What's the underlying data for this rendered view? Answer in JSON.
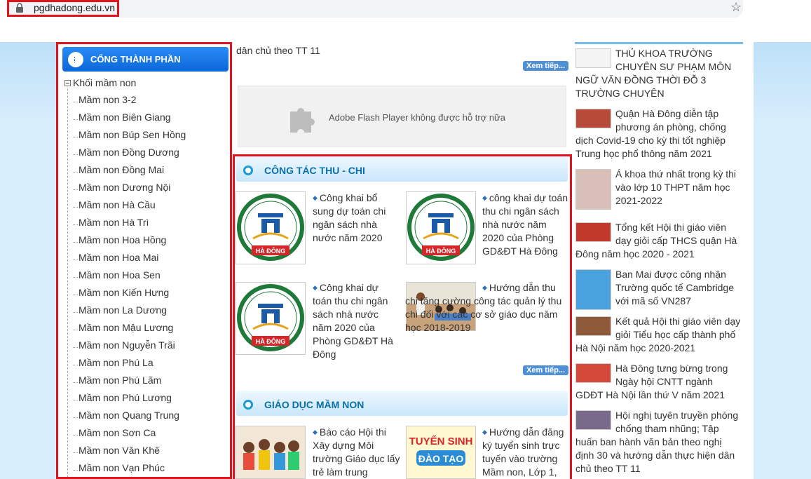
{
  "browser": {
    "url": "pgdhadong.edu.vn"
  },
  "sidebar": {
    "header": "CỔNG THÀNH PHẦN",
    "tree_root": "Khối mầm non",
    "items": [
      "Mầm non 3-2",
      "Mầm non Biên Giang",
      "Mầm non Búp Sen Hồng",
      "Mầm non Đồng Dương",
      "Mầm non Đồng Mai",
      "Mầm non Dương Nội",
      "Mầm non Hà Cầu",
      "Mầm non Hà Trì",
      "Mầm non Hoa Hồng",
      "Mầm non Hoa Mai",
      "Mầm non Hoa Sen",
      "Mầm non Kiến Hưng",
      "Mầm non La Dương",
      "Mầm non Mậu Lương",
      "Mầm non Nguyễn Trãi",
      "Mầm non Phú La",
      "Mầm non Phú Lãm",
      "Mầm non Phú Lương",
      "Mầm non Quang Trung",
      "Mầm non Sơn Ca",
      "Mầm non Văn Khê",
      "Mầm non Vạn Phúc"
    ]
  },
  "middle": {
    "top_text": "dân chủ theo TT 11",
    "more_label": "Xem tiếp...",
    "flash_text": "Adobe Flash Player không được hỗ trợ nữa",
    "section1": {
      "title": "CÔNG TÁC THU - CHI",
      "news": [
        "Công khai bổ sung dự toán chi ngân sách nhà nước năm 2020",
        "công khai dự toán thu chi ngân sách nhà nước năm 2020 của Phòng GD&ĐT Hà Đông",
        "Công khai dự toán thu chi ngân sách nhà nước năm 2020 của Phòng GD&ĐT Hà Đông",
        "Hướng dẫn thu chi tăng cường công tác quản lý thu chi đối với các cơ sở giáo dục năm học 2018-2019"
      ]
    },
    "section2": {
      "title": "GIÁO DỤC MẦM NON",
      "news": [
        "Báo cáo Hội thi Xây dựng Môi trường Giáo dục lấy trẻ làm trung",
        "Hướng dẫn đăng ký tuyển sinh trực tuyến vào trường Mầm non, Lớp 1,"
      ]
    },
    "logo_text": "HÀ ĐÔNG",
    "tuyen_sinh_text": "TUYỂN SINH",
    "dao_tao_text": "ĐÀO TẠO"
  },
  "right": {
    "news": [
      "THỦ KHOA TRƯỜNG CHUYÊN SƯ PHẠM MÔN NGỮ VĂN ĐỒNG THỜI ĐỖ 3 TRƯỜNG CHUYÊN",
      "Quận Hà Đông diễn tập phương án phòng, chống dịch Covid-19 cho kỳ thi tốt nghiệp Trung học phổ thông năm 2021",
      "Á khoa thứ nhất trong kỳ thi vào lớp 10 THPT năm học 2021-2022",
      "Tổng kết Hội thi giáo viên dạy giỏi cấp THCS quận Hà Đông năm học 2020 - 2021",
      "Ban Mai được công nhận Trường quốc tế Cambridge với mã số VN287",
      "Kết quả Hội thi giáo viên dạy giỏi Tiểu học cấp thành phố Hà Nội năm học 2020-2021",
      "Hà Đông tưng bừng trong Ngày hội CNTT ngành GDĐT Hà Nội lần thứ V năm 2021",
      "Hội nghị tuyên truyền phòng chống tham nhũng; Tập huấn ban hành văn bản theo nghị định 30 và hướng dẫn thực hiện dân chủ theo TT 11"
    ]
  },
  "colors": {
    "highlight": "#e0141e",
    "header_blue": "#0a66d9",
    "section_title": "#0b6fa8"
  }
}
